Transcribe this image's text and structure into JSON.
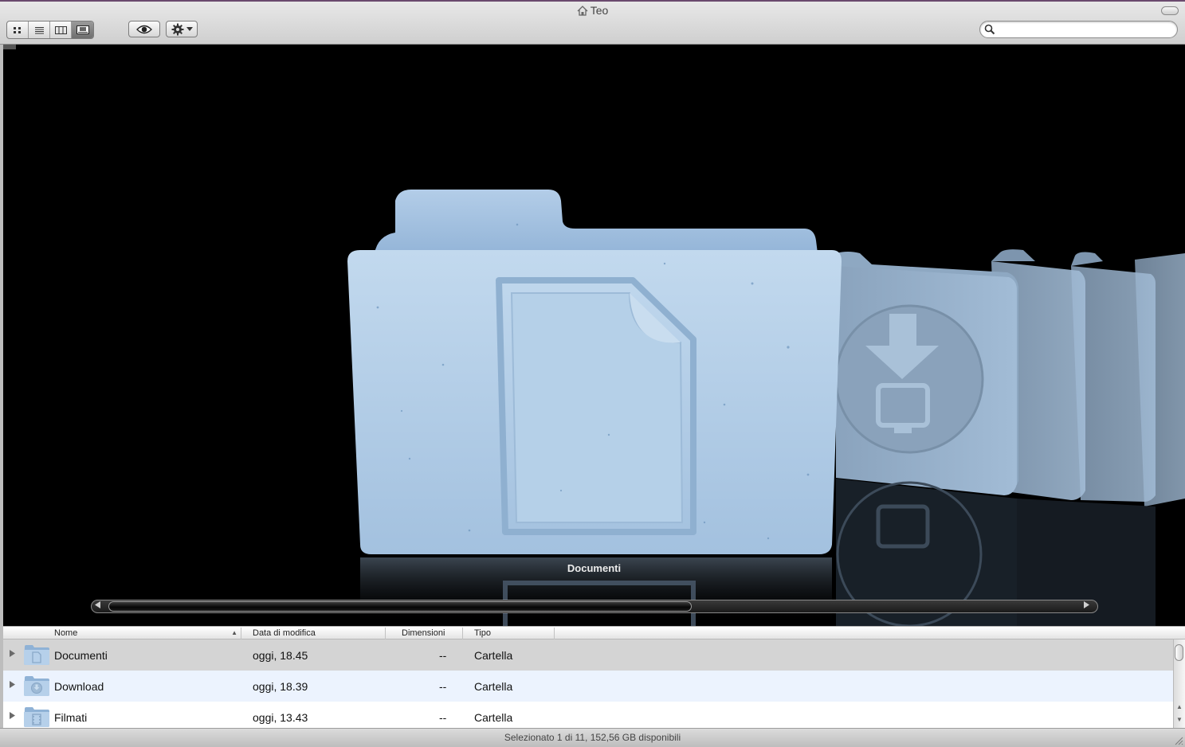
{
  "window": {
    "title": "Teo"
  },
  "toolbar": {
    "view_modes": [
      "icon-view",
      "list-view",
      "column-view",
      "cover-flow-view"
    ],
    "active_view": "cover-flow-view",
    "search": {
      "value": "",
      "placeholder": ""
    }
  },
  "coverflow": {
    "selected_caption": "Documenti"
  },
  "list": {
    "columns": [
      "Nome",
      "Data di modifica",
      "Dimensioni",
      "Tipo"
    ],
    "sort_column": "Nome",
    "rows": [
      {
        "name": "Documenti",
        "modified": "oggi, 18.45",
        "size": "--",
        "kind": "Cartella",
        "icon": "documents-folder-icon",
        "state": "selected"
      },
      {
        "name": "Download",
        "modified": "oggi, 18.39",
        "size": "--",
        "kind": "Cartella",
        "icon": "downloads-folder-icon",
        "state": "alternate"
      },
      {
        "name": "Filmati",
        "modified": "oggi, 13.43",
        "size": "--",
        "kind": "Cartella",
        "icon": "movies-folder-icon",
        "state": "normal"
      }
    ]
  },
  "status_bar": {
    "text": "Selezionato 1 di 11, 152,56 GB disponibili"
  },
  "colors": {
    "selected_row": "#d4d4d4",
    "alternate_row": "#ecf3fe",
    "folder_blue": "#a9c7e4",
    "coverflow_bg": "#000000"
  }
}
